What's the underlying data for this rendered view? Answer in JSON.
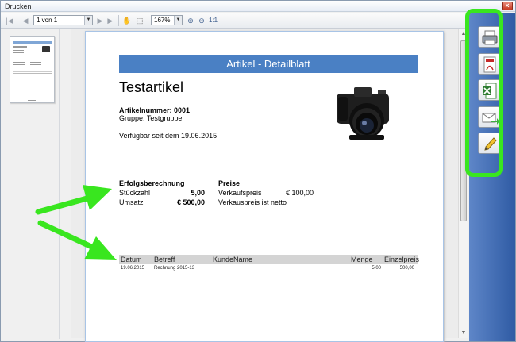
{
  "window": {
    "title": "Drucken",
    "close_label": "×"
  },
  "toolbar": {
    "page_value": "1 von 1",
    "zoom_value": "167%",
    "zoom_ratio_label": "1:1"
  },
  "document": {
    "header": "Artikel - Detailblatt",
    "article_title": "Testartikel",
    "article_number": "Artikelnummer: 0001",
    "group": "Gruppe: Testgruppe",
    "available": "Verfügbar seit dem 19.06.2015",
    "success": {
      "heading": "Erfolgsberechnung",
      "rows": [
        {
          "label": "Stückzahl",
          "value": "5,00"
        },
        {
          "label": "Umsatz",
          "value": "€ 500,00"
        }
      ]
    },
    "prices": {
      "heading": "Preise",
      "sale_label": "Verkaufspreis",
      "sale_value": "€ 100,00",
      "net_note": "Verkauspreis ist netto"
    },
    "table": {
      "columns": [
        "Datum",
        "Betreff",
        "KundeName",
        "Menge",
        "Einzelpreis"
      ],
      "rows": [
        [
          "19.06.2015",
          "Rechnung 2015-13",
          "",
          "5,00",
          "500,00"
        ]
      ]
    }
  },
  "actions": [
    {
      "name": "print-icon"
    },
    {
      "name": "pdf-icon"
    },
    {
      "name": "excel-icon"
    },
    {
      "name": "email-icon"
    },
    {
      "name": "edit-pencil-icon"
    }
  ],
  "colors": {
    "accent": "#4a80c4",
    "highlight_green": "#39e61f",
    "panel_blue": "#2f5ba4"
  }
}
